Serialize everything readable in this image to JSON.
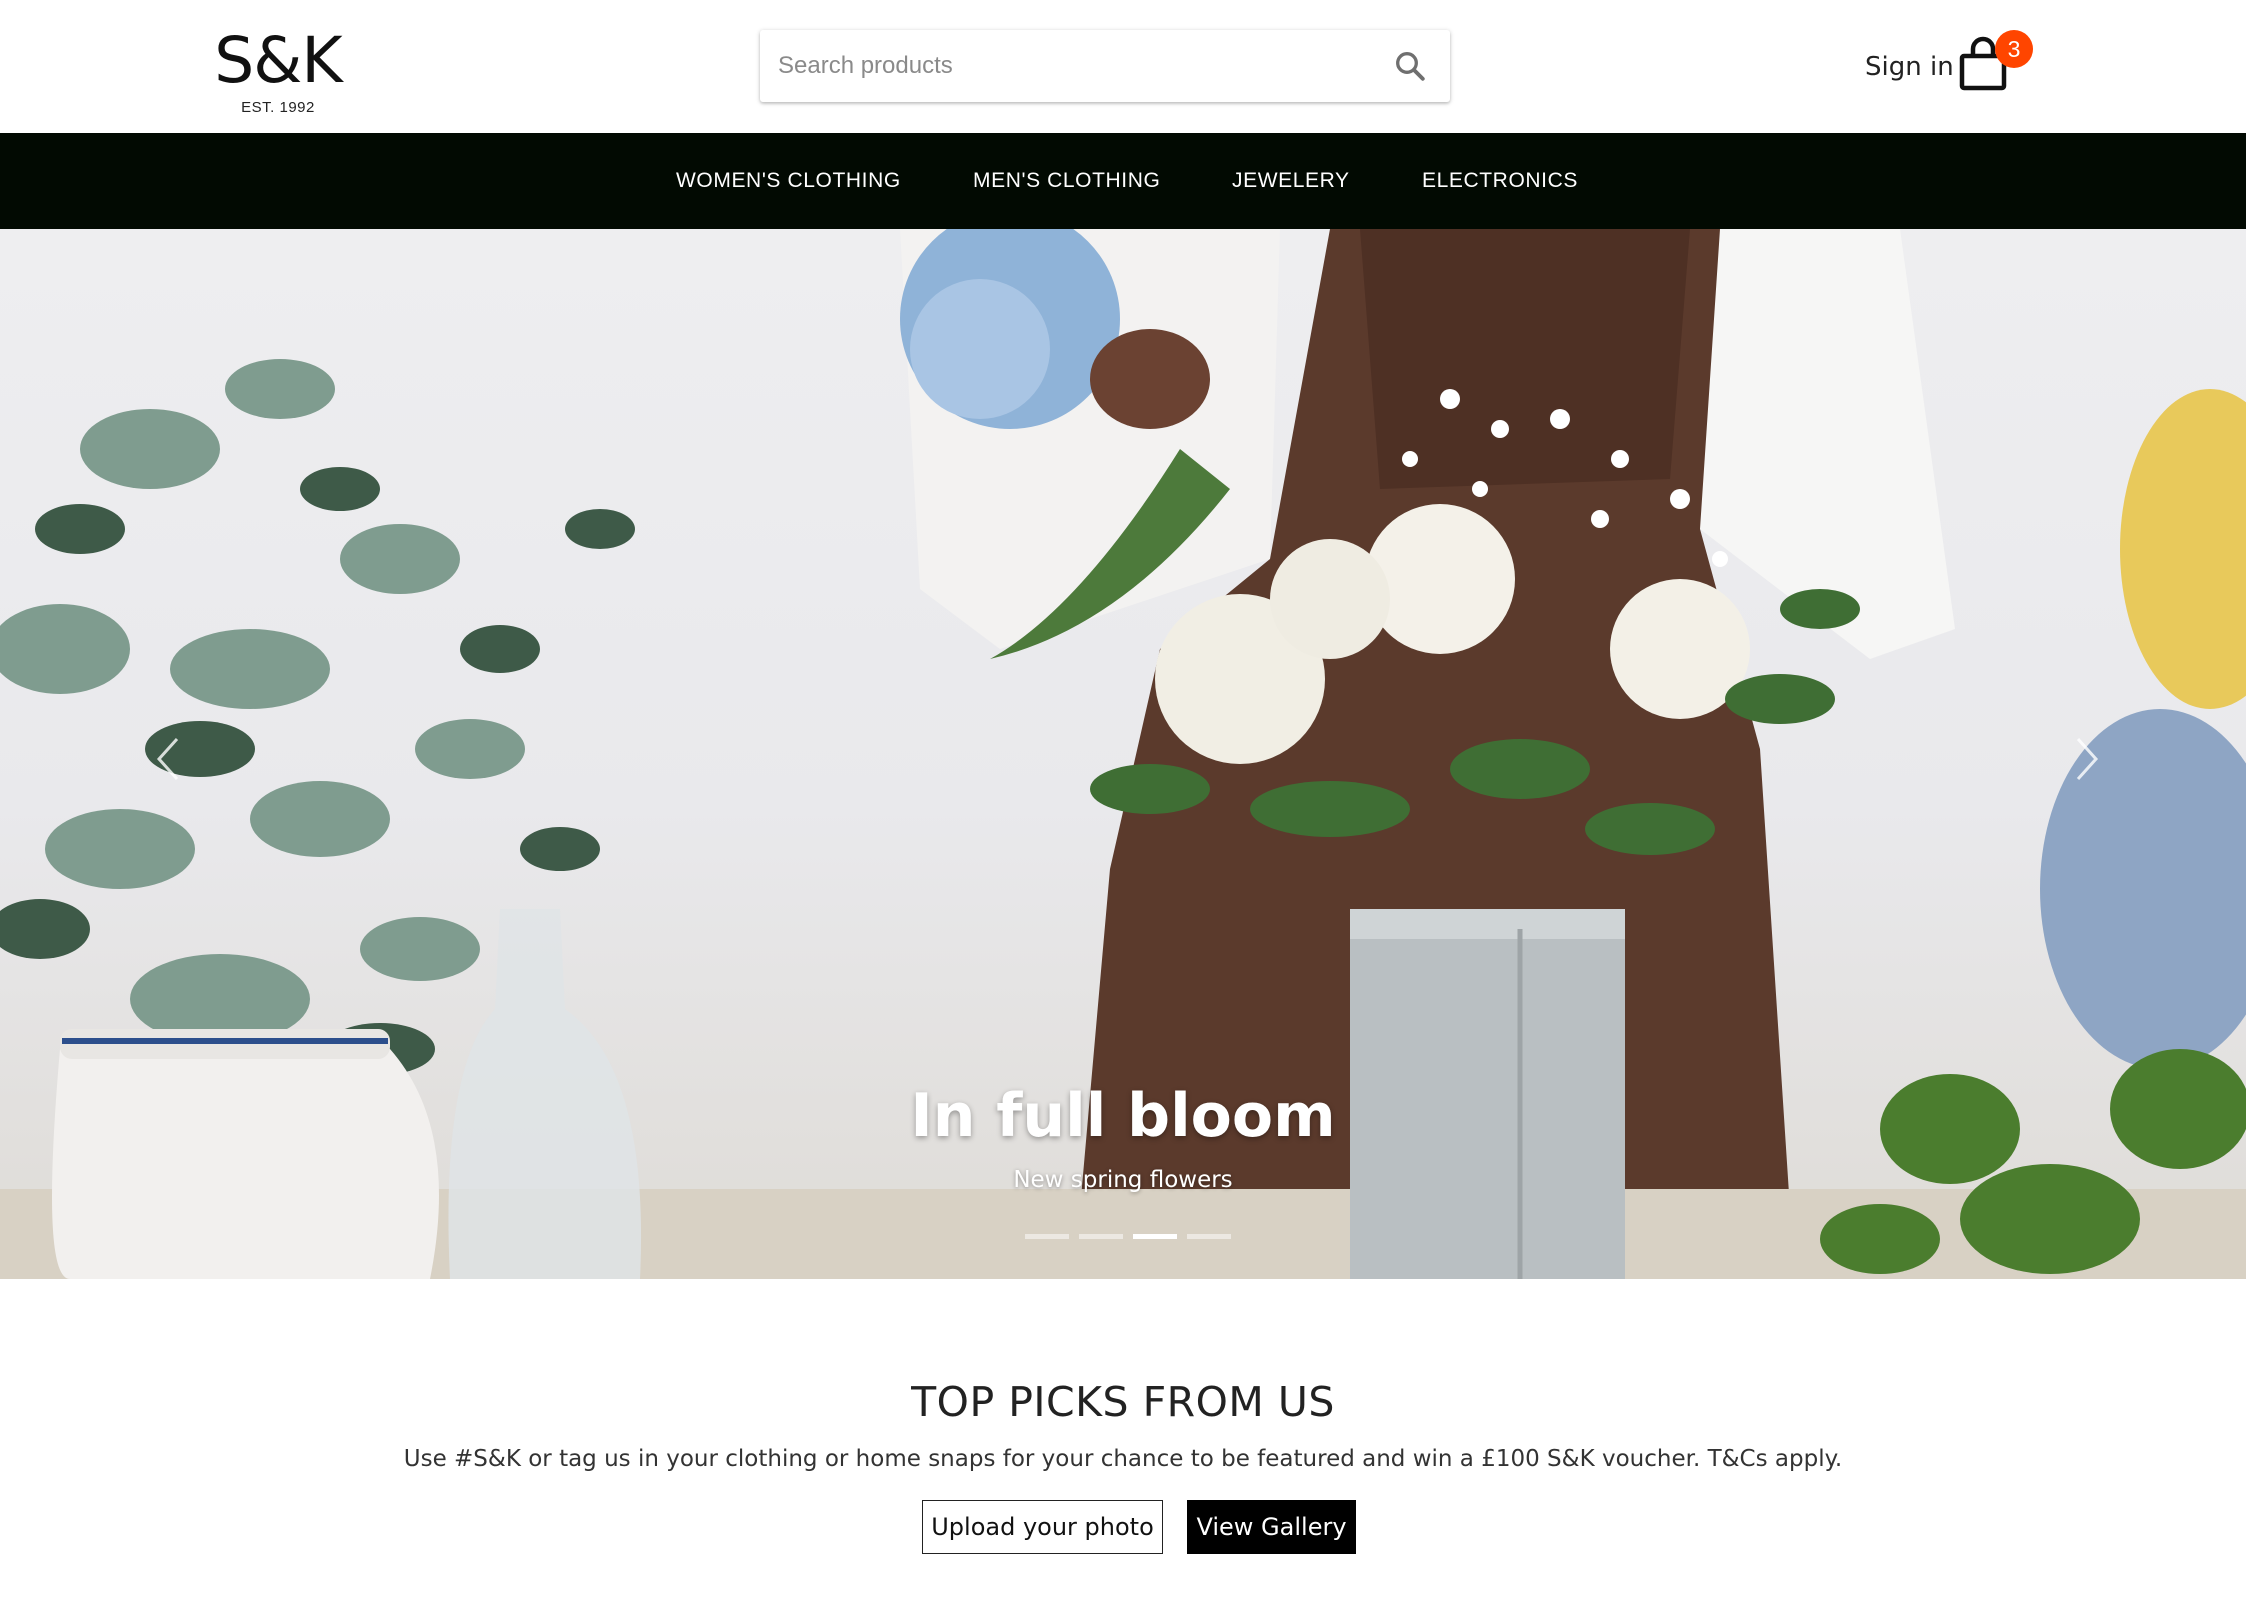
{
  "header": {
    "logo_text": "S&K",
    "logo_subtext": "EST. 1992",
    "search_placeholder": "Search products",
    "search_icon": "search-icon",
    "signin_label": "Sign in",
    "cart_icon": "shopping-bag-icon",
    "cart_count": "3",
    "badge_color": "#ff4500"
  },
  "nav": {
    "background": "#020a02",
    "items": [
      {
        "label": "WOMEN'S CLOTHING"
      },
      {
        "label": "MEN'S CLOTHING"
      },
      {
        "label": "JEWELERY"
      },
      {
        "label": "ELECTRONICS"
      }
    ]
  },
  "hero": {
    "title": "In full bloom",
    "subtitle": "New spring flowers",
    "slide_count": 4,
    "active_slide": 3,
    "prev_icon": "chevron-left-icon",
    "next_icon": "chevron-right-icon"
  },
  "section": {
    "title": "TOP PICKS FROM US",
    "text": "Use #S&K or tag us in your clothing or home snaps for your chance to be featured and win a £100 S&K voucher. T&Cs apply.",
    "upload_label": "Upload your photo",
    "gallery_label": "View Gallery"
  }
}
